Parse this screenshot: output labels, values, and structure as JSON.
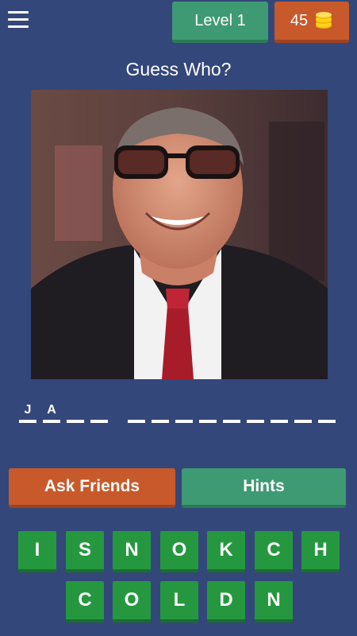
{
  "header": {
    "menu_icon": "hamburger-menu-icon",
    "level_label": "Level 1",
    "coins": "45",
    "coins_icon": "coin-stack-icon"
  },
  "title": "Guess Who?",
  "answer": {
    "slots": [
      "J",
      "A",
      "",
      "",
      "",
      "",
      "",
      "",
      "",
      "",
      "",
      "",
      ""
    ]
  },
  "buttons": {
    "ask_friends": "Ask Friends",
    "hints": "Hints"
  },
  "keyboard": {
    "row1": [
      "I",
      "S",
      "N",
      "O",
      "K",
      "C",
      "H"
    ],
    "row2": [
      "C",
      "O",
      "L",
      "D",
      "N"
    ]
  },
  "colors": {
    "background": "#34477a",
    "green": "#3e9a73",
    "orange": "#c7592a",
    "key_green": "#25983f"
  }
}
